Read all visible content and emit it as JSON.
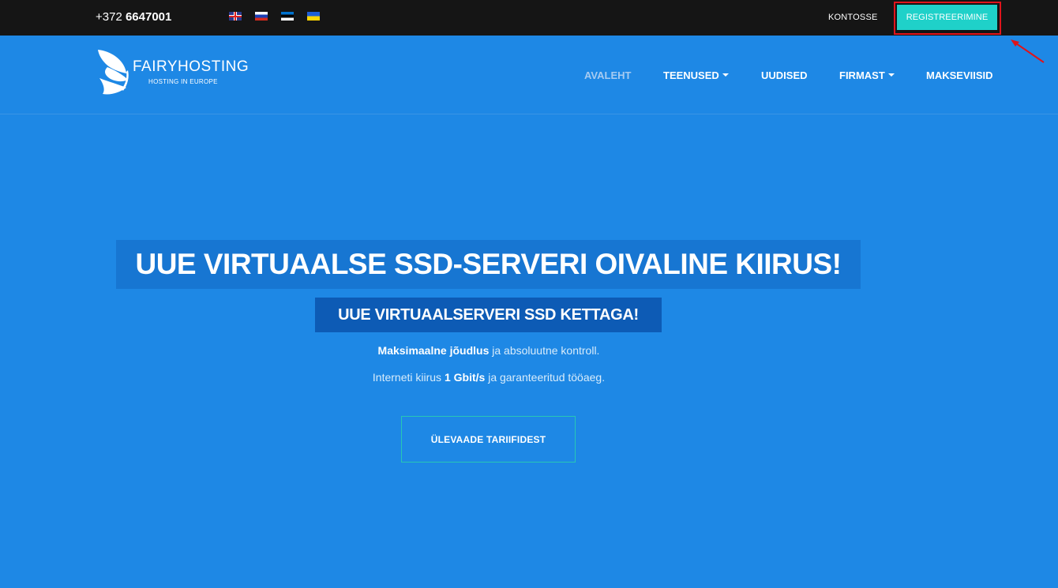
{
  "topbar": {
    "phone_prefix": "+372",
    "phone_number": "6647001",
    "languages": [
      {
        "code": "en",
        "icon": "flag-uk-icon"
      },
      {
        "code": "ru",
        "icon": "flag-ru-icon"
      },
      {
        "code": "et",
        "icon": "flag-ee-icon"
      },
      {
        "code": "uk",
        "icon": "flag-ua-icon"
      }
    ],
    "login_label": "KONTOSSE",
    "register_label": "REGISTREERIMINE",
    "highlight_color": "#e0141b",
    "register_color": "#1fd1c9"
  },
  "header": {
    "logo_name": "FAIRYHOSTING",
    "logo_tagline": "HOSTING IN EUROPE",
    "nav": [
      {
        "label": "AVALEHT",
        "active": true
      },
      {
        "label": "TEENUSED",
        "dropdown": true
      },
      {
        "label": "UUDISED"
      },
      {
        "label": "FIRMAST",
        "dropdown": true
      },
      {
        "label": "MAKSEVIISID"
      }
    ]
  },
  "hero": {
    "title": "UUE VIRTUAALSE SSD-SERVERI OIVALINE KIIRUS!",
    "subtitle": "UUE VIRTUAALSERVERI SSD KETTAGA!",
    "line1_bold": "Maksimaalne jõudlus",
    "line1_rest": " ja absoluutne kontroll.",
    "line2_pre": "Interneti kiirus ",
    "line2_bold": "1 Gbit/s",
    "line2_post": " ja garanteeritud tööaeg.",
    "cta_label": "ÜLEVAADE TARIIFIDEST",
    "background_color": "#1e88e5"
  }
}
